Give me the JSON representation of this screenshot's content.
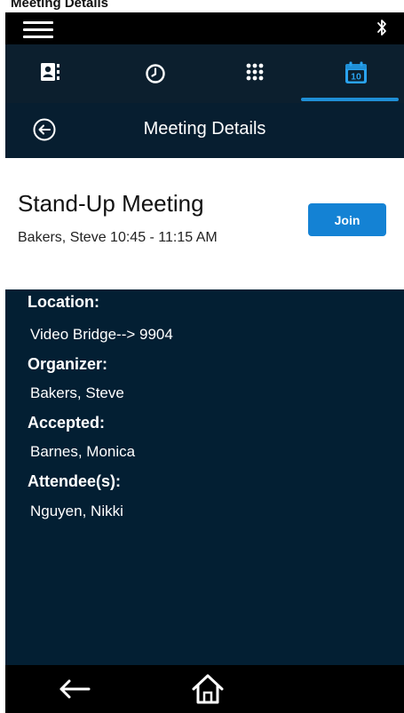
{
  "window": {
    "title": "Meeting Details"
  },
  "status_bar": {
    "menu_icon": "hamburger-menu-icon",
    "bluetooth_icon": "bluetooth-icon"
  },
  "tabs": [
    {
      "id": "contacts",
      "icon": "contacts-icon",
      "selected": false
    },
    {
      "id": "recents",
      "icon": "clock-icon",
      "selected": false
    },
    {
      "id": "dialpad",
      "icon": "dialpad-icon",
      "selected": false
    },
    {
      "id": "calendar",
      "icon": "calendar-icon",
      "selected": true,
      "day": "10"
    }
  ],
  "header": {
    "back_icon": "back-circle-icon",
    "title": "Meeting Details"
  },
  "meeting": {
    "title": "Stand-Up Meeting",
    "subtitle": "Bakers, Steve  10:45 - 11:15 AM",
    "join_label": "Join"
  },
  "details": {
    "location_label": "Location:",
    "location_value": "Video Bridge--> 9904",
    "organizer_label": "Organizer:",
    "organizer_value": "Bakers, Steve",
    "accepted_label": "Accepted:",
    "accepted_value": "Barnes, Monica",
    "attendees_label": "Attendee(s):",
    "attendees_value": "Nguyen, Nikki"
  },
  "nav": {
    "back_icon": "back-arrow-icon",
    "home_icon": "home-icon"
  },
  "colors": {
    "status_bar": "#000000",
    "tab_bar": "#0c1f2e",
    "header_bar": "#071e30",
    "details_panel": "#031f33",
    "accent": "#1f8fd6",
    "join_button": "#1482d4"
  }
}
